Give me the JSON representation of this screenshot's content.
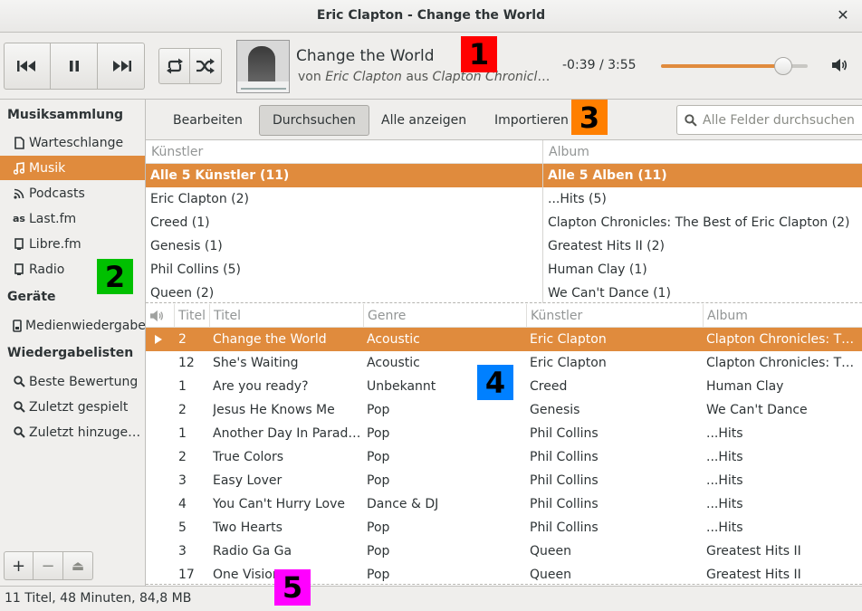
{
  "window": {
    "title": "Eric Clapton - Change the World",
    "close_icon": "close-icon"
  },
  "player": {
    "now_playing_title": "Change the World",
    "sub_prefix": "von ",
    "sub_artist": "Eric Clapton",
    "sub_middle": " aus ",
    "sub_album": "Clapton Chronicles: The Best of Eric Clapton",
    "time": "-0:39 / 3:55",
    "progress_fraction": 0.834,
    "accent_color": "#e08b3d"
  },
  "sidebar": {
    "sections": [
      {
        "heading": "Musiksammlung"
      },
      {
        "heading": "Geräte"
      },
      {
        "heading": "Wiedergabelisten"
      }
    ],
    "items": [
      {
        "label": "Warteschlange",
        "icon": "document-icon"
      },
      {
        "label": "Musik",
        "icon": "music-note-icon",
        "active": true
      },
      {
        "label": "Podcasts",
        "icon": "rss-icon"
      },
      {
        "label": "Last.fm",
        "icon": "lastfm-icon"
      },
      {
        "label": "Libre.fm",
        "icon": "radio-icon"
      },
      {
        "label": "Radio",
        "icon": "radio-icon"
      },
      {
        "label": "Medienwiedergabe",
        "icon": "media-player-icon"
      },
      {
        "label": "Beste Bewertung",
        "icon": "search-icon"
      },
      {
        "label": "Zuletzt gespielt",
        "icon": "search-icon"
      },
      {
        "label": "Zuletzt hinzugefügt",
        "icon": "search-icon"
      }
    ],
    "bottom_buttons": [
      "+",
      "−",
      "⏏"
    ]
  },
  "browse_toolbar": {
    "buttons": [
      "Bearbeiten",
      "Durchsuchen",
      "Alle anzeigen",
      "Importieren"
    ],
    "active_index": 1,
    "search_placeholder": "Alle Felder durchsuchen"
  },
  "artist_pane": {
    "header": "Künstler",
    "rows": [
      "Alle 5 Künstler (11)",
      "Eric Clapton (2)",
      "Creed (1)",
      "Genesis (1)",
      "Phil Collins (5)",
      "Queen (2)"
    ]
  },
  "album_pane": {
    "header": "Album",
    "rows": [
      "Alle 5 Alben (11)",
      "...Hits (5)",
      "Clapton Chronicles: The Best of Eric Clapton (2)",
      "Greatest Hits II (2)",
      "Human Clay (1)",
      "We Can't Dance (1)"
    ]
  },
  "tracklist": {
    "columns": [
      "Titel",
      "Titel",
      "Genre",
      "Künstler",
      "Album"
    ],
    "rows": [
      {
        "track": "2",
        "title": "Change the World",
        "genre": "Acoustic",
        "artist": "Eric Clapton",
        "album": "Clapton Chronicles: The Best of Eric Clapton",
        "playing": true
      },
      {
        "track": "12",
        "title": "She's Waiting",
        "genre": "Acoustic",
        "artist": "Eric Clapton",
        "album": "Clapton Chronicles: The Best of Eric Clapton"
      },
      {
        "track": "1",
        "title": "Are you ready?",
        "genre": "Unbekannt",
        "artist": "Creed",
        "album": "Human Clay"
      },
      {
        "track": "2",
        "title": "Jesus He Knows Me",
        "genre": "Pop",
        "artist": "Genesis",
        "album": "We Can't Dance"
      },
      {
        "track": "1",
        "title": "Another Day In Paradise",
        "genre": "Pop",
        "artist": "Phil Collins",
        "album": "...Hits"
      },
      {
        "track": "2",
        "title": "True Colors",
        "genre": "Pop",
        "artist": "Phil Collins",
        "album": "...Hits"
      },
      {
        "track": "3",
        "title": "Easy Lover",
        "genre": "Pop",
        "artist": "Phil Collins",
        "album": "...Hits"
      },
      {
        "track": "4",
        "title": "You Can't Hurry Love",
        "genre": "Dance & DJ",
        "artist": "Phil Collins",
        "album": "...Hits"
      },
      {
        "track": "5",
        "title": "Two Hearts",
        "genre": "Pop",
        "artist": "Phil Collins",
        "album": "...Hits"
      },
      {
        "track": "3",
        "title": "Radio Ga Ga",
        "genre": "Pop",
        "artist": "Queen",
        "album": "Greatest Hits II"
      },
      {
        "track": "17",
        "title": "One Vision",
        "genre": "Pop",
        "artist": "Queen",
        "album": "Greatest Hits II"
      }
    ]
  },
  "status": {
    "text": "11 Titel, 48 Minuten, 84,8 MB"
  },
  "markers": [
    {
      "label": "1",
      "color": "#ff0000"
    },
    {
      "label": "2",
      "color": "#00c000"
    },
    {
      "label": "3",
      "color": "#ff7f00"
    },
    {
      "label": "4",
      "color": "#0080ff"
    },
    {
      "label": "5",
      "color": "#ff00ff"
    }
  ]
}
